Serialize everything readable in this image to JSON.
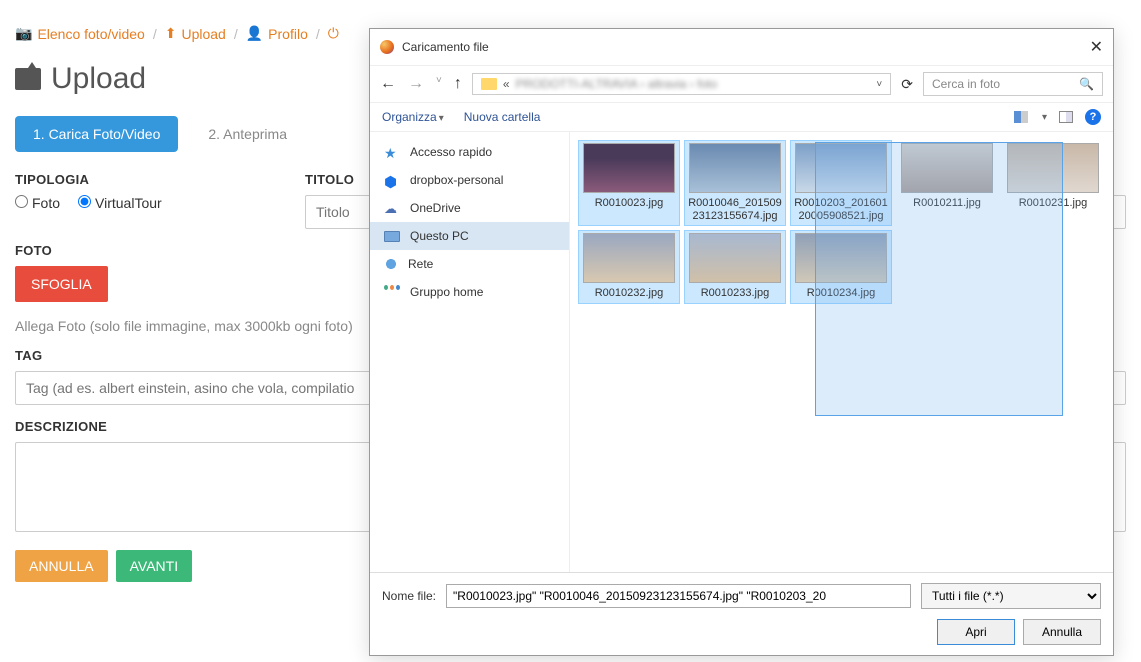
{
  "breadcrumb": {
    "item1": "Elenco foto/video",
    "item2": "Upload",
    "item3": "Profilo"
  },
  "page_title": "Upload",
  "steps": {
    "active": "1. Carica Foto/Video",
    "inactive": "2. Anteprima"
  },
  "form": {
    "tipologia_label": "TIPOLOGIA",
    "radio_foto": "Foto",
    "radio_vt": "VirtualTour",
    "titolo_label": "TITOLO",
    "titolo_placeholder": "Titolo",
    "foto_label": "FOTO",
    "browse_btn": "SFOGLIA",
    "foto_help": "Allega Foto (solo file immagine, max 3000kb ogni foto)",
    "tag_label": "TAG",
    "tag_placeholder": "Tag (ad es. albert einstein, asino che vola, compilatio",
    "descr_label": "DESCRIZIONE"
  },
  "actions": {
    "cancel": "ANNULLA",
    "next": "AVANTI"
  },
  "dialog": {
    "title": "Caricamento file",
    "path_prefix": "«",
    "path_blur": "PRODOTTI-ALTRAVIA › altravia › foto",
    "search_placeholder": "Cerca in foto",
    "organize": "Organizza",
    "new_folder": "Nuova cartella",
    "sidebar": {
      "quick": "Accesso rapido",
      "dropbox": "dropbox-personal",
      "onedrive": "OneDrive",
      "thispc": "Questo PC",
      "network": "Rete",
      "homegroup": "Gruppo home"
    },
    "files": [
      {
        "name": "R0010023.jpg",
        "sel": true,
        "t": "t1"
      },
      {
        "name": "R0010046_20150923123155674.jpg",
        "sel": true,
        "t": "t2"
      },
      {
        "name": "R0010203_20160120005908521.jpg",
        "sel": true,
        "t": "t3"
      },
      {
        "name": "R0010211.jpg",
        "sel": false,
        "t": "t4"
      },
      {
        "name": "R0010231.jpg",
        "sel": false,
        "t": "t5"
      },
      {
        "name": "R0010232.jpg",
        "sel": true,
        "t": "t6"
      },
      {
        "name": "R0010233.jpg",
        "sel": true,
        "t": "t7"
      },
      {
        "name": "R0010234.jpg",
        "sel": true,
        "t": "t8"
      }
    ],
    "filename_label": "Nome file:",
    "filename_value": "\"R0010023.jpg\" \"R0010046_20150923123155674.jpg\" \"R0010203_20",
    "filetype": "Tutti i file (*.*)",
    "open_btn": "Apri",
    "cancel_btn": "Annulla"
  }
}
